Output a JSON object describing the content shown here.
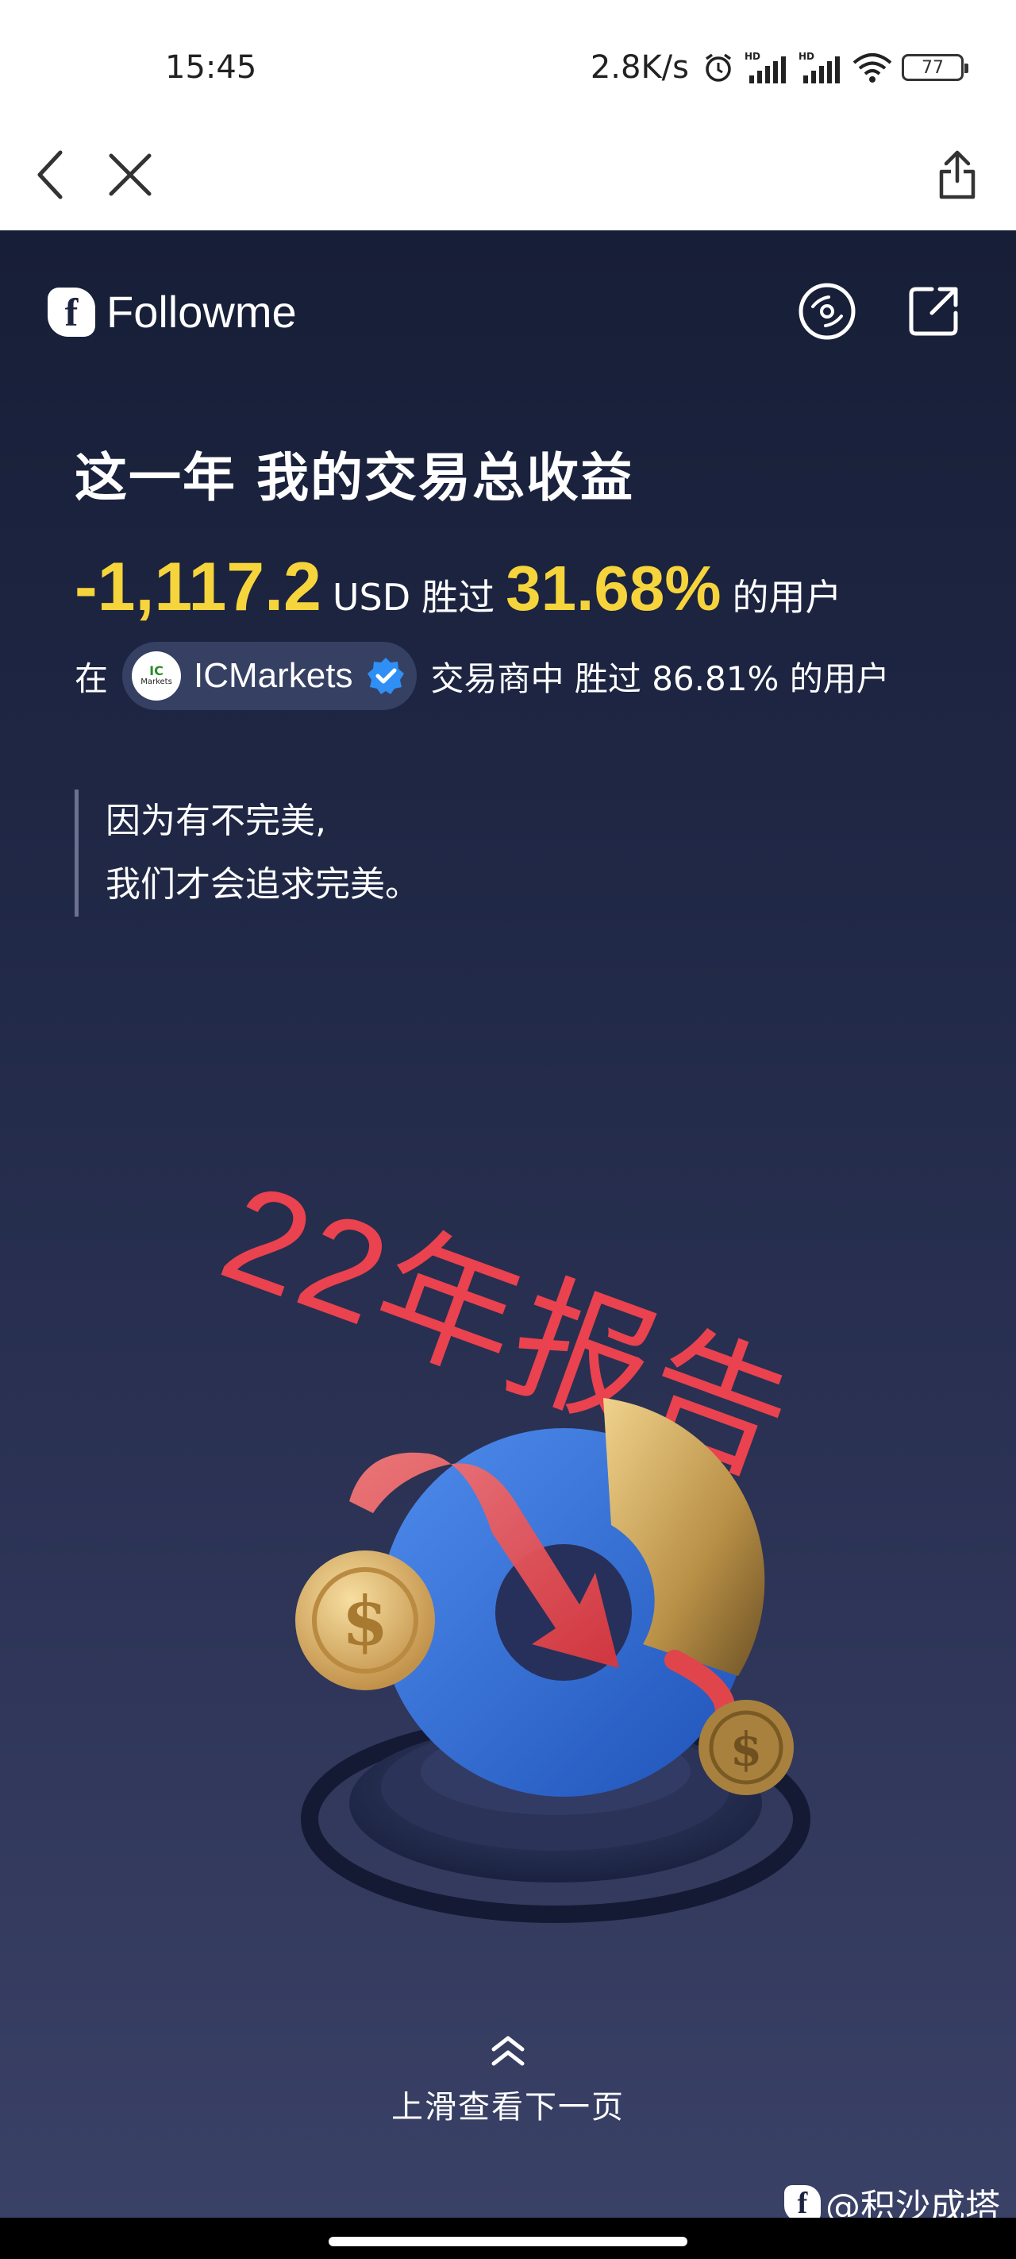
{
  "status_bar": {
    "time": "15:45",
    "speed": "2.8K/s",
    "battery": "77",
    "icons": [
      "alarm-icon",
      "signal-hd-icon",
      "signal-hd-icon",
      "wifi-icon",
      "battery-icon"
    ]
  },
  "nav": {
    "icons": [
      "back-icon",
      "close-icon",
      "share-icon"
    ]
  },
  "brand": {
    "name": "Followme",
    "logo_letter": "f"
  },
  "report": {
    "headline": "这一年 我的交易总收益",
    "profit_value": "-1,117.2",
    "currency": "USD",
    "beat_prefix": "胜过",
    "beat_pct": "31.68%",
    "beat_suffix": "的用户",
    "broker_prefix": "在",
    "broker_name": "ICMarkets",
    "broker_logo_top": "IC",
    "broker_logo_bottom": "Markets",
    "broker_suffix": "交易商中 胜过 86.81% 的用户",
    "quote_line1": "因为有不完美,",
    "quote_line2": "我们才会追求完美。",
    "stamp": "22年报告"
  },
  "swipe": {
    "label": "上滑查看下一页"
  },
  "watermark": {
    "text": "@积沙成塔"
  },
  "colors": {
    "accent_yellow": "#f6d43c",
    "stamp_red": "#f2434f",
    "bg_top": "#171e37",
    "bg_bottom": "#3a4166"
  }
}
